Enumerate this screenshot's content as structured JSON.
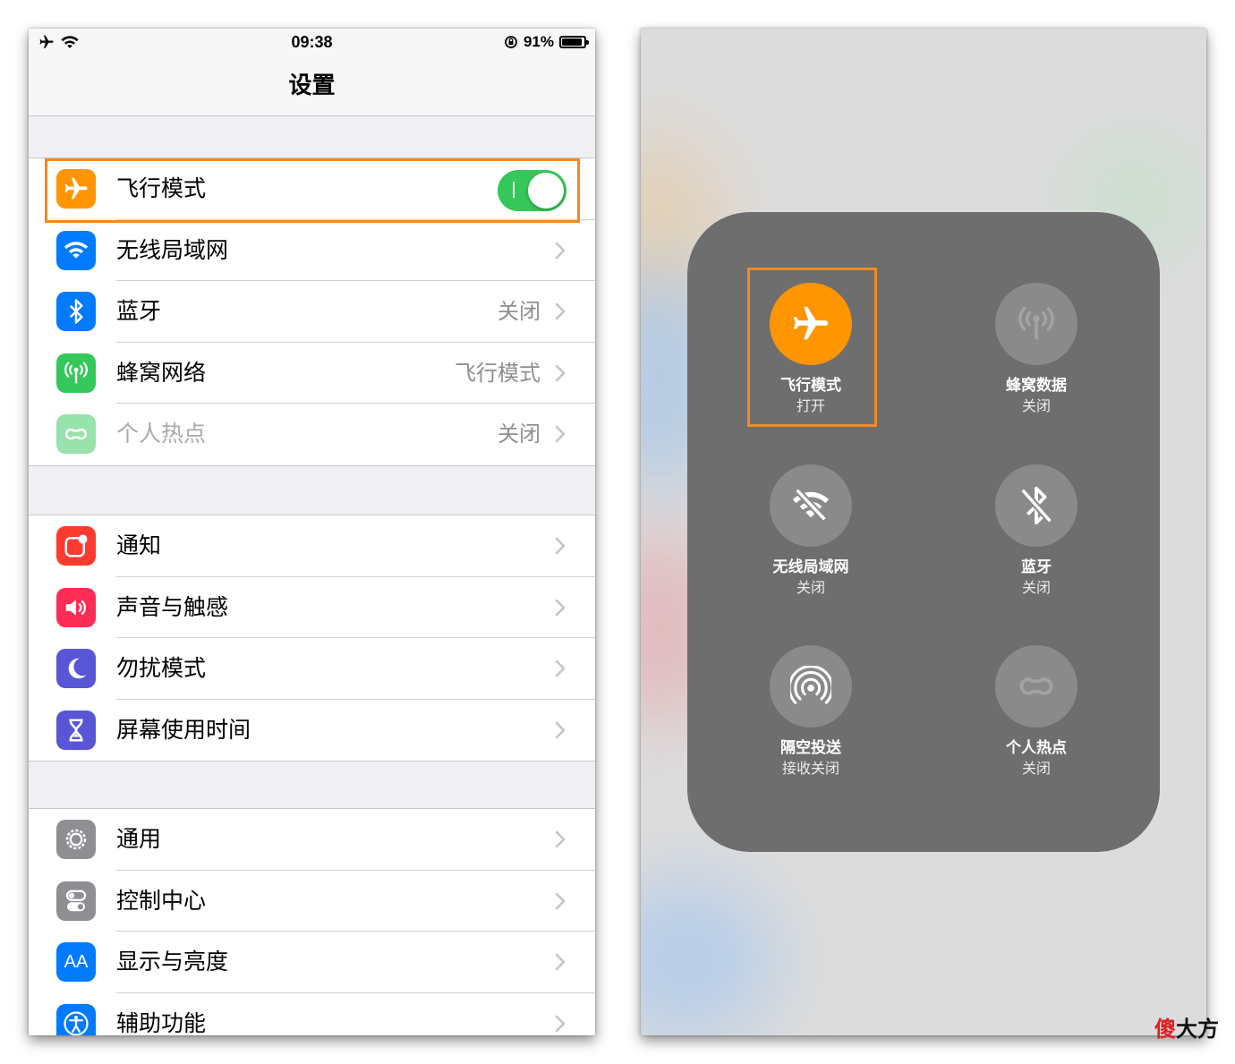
{
  "status_bar": {
    "time": "09:38",
    "battery": "91%",
    "battery_level": 0.91
  },
  "settings": {
    "title": "设置",
    "group1": [
      {
        "name": "airplane",
        "label": "飞行模式",
        "value": "",
        "toggle": true,
        "icon": "airplane-icon",
        "color": "#ff9500"
      },
      {
        "name": "wifi",
        "label": "无线局域网",
        "value": "",
        "icon": "wifi-icon",
        "color": "#007aff"
      },
      {
        "name": "bluetooth",
        "label": "蓝牙",
        "value": "关闭",
        "icon": "bluetooth-icon",
        "color": "#007aff"
      },
      {
        "name": "cellular",
        "label": "蜂窝网络",
        "value": "飞行模式",
        "icon": "antenna-icon",
        "color": "#34c759"
      },
      {
        "name": "hotspot",
        "label": "个人热点",
        "value": "关闭",
        "icon": "hotspot-icon",
        "color": "#34c759"
      }
    ],
    "group2": [
      {
        "name": "notifications",
        "label": "通知",
        "icon": "notification-icon",
        "color": "#ff3b30"
      },
      {
        "name": "sounds",
        "label": "声音与触感",
        "icon": "speaker-icon",
        "color": "#ff2d55"
      },
      {
        "name": "dnd",
        "label": "勿扰模式",
        "icon": "moon-icon",
        "color": "#5856d6"
      },
      {
        "name": "screentime",
        "label": "屏幕使用时间",
        "icon": "hourglass-icon",
        "color": "#5856d6"
      }
    ],
    "group3": [
      {
        "name": "general",
        "label": "通用",
        "icon": "gear-icon",
        "color": "#8e8e93"
      },
      {
        "name": "control-center",
        "label": "控制中心",
        "icon": "switches-icon",
        "color": "#8e8e93"
      },
      {
        "name": "display",
        "label": "显示与亮度",
        "icon": "aa-icon",
        "text_icon": "AA",
        "color": "#007aff"
      },
      {
        "name": "accessibility",
        "label": "辅助功能",
        "icon": "accessibility-icon",
        "color": "#007aff"
      }
    ]
  },
  "control_center": {
    "items": [
      {
        "name": "airplane",
        "title": "飞行模式",
        "sub": "打开",
        "on": true,
        "icon": "airplane-icon"
      },
      {
        "name": "cellular",
        "title": "蜂窝数据",
        "sub": "关闭",
        "on": false,
        "icon": "antenna-icon"
      },
      {
        "name": "wifi",
        "title": "无线局域网",
        "sub": "关闭",
        "on": false,
        "icon": "wifi-off-icon"
      },
      {
        "name": "bluetooth",
        "title": "蓝牙",
        "sub": "关闭",
        "on": false,
        "icon": "bluetooth-off-icon"
      },
      {
        "name": "airdrop",
        "title": "隔空投送",
        "sub": "接收关闭",
        "on": false,
        "icon": "airdrop-icon"
      },
      {
        "name": "hotspot",
        "title": "个人热点",
        "sub": "关闭",
        "on": false,
        "icon": "hotspot-icon"
      }
    ],
    "accent": "#ff9500",
    "highlight_color": "#f08a24"
  },
  "watermark": {
    "first": "傻",
    "rest": "大方"
  }
}
